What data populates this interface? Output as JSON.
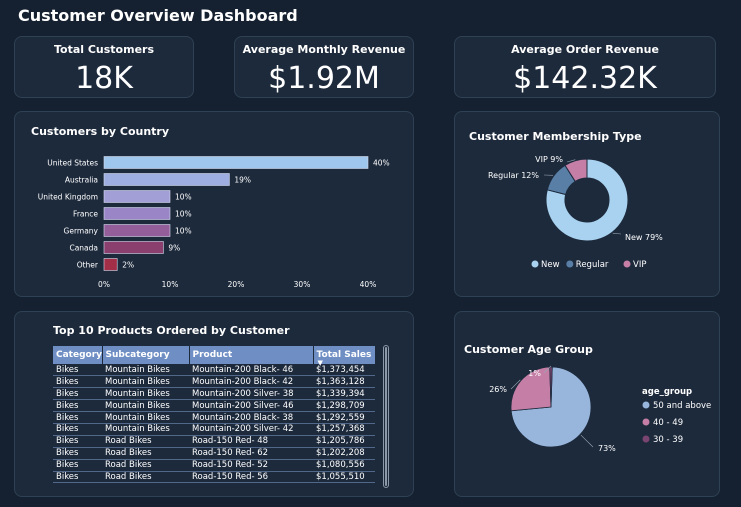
{
  "page": {
    "title": "Customer Overview Dashboard"
  },
  "kpis": {
    "total_customers": {
      "label": "Total Customers",
      "value": "18K"
    },
    "avg_monthly_revenue": {
      "label": "Average Monthly Revenue",
      "value": "$1.92M"
    },
    "avg_order_revenue": {
      "label": "Average Order Revenue",
      "value": "$142.32K"
    }
  },
  "country_chart": {
    "title": "Customers by Country",
    "colors": [
      "#9fc6ec",
      "#9eaee0",
      "#a29ed6",
      "#9a86c6",
      "#935e9a",
      "#8a3f6e",
      "#a32e48"
    ]
  },
  "membership_chart": {
    "title": "Customer Membership Type",
    "colors": {
      "New": "#a8d2f0",
      "Regular": "#5a7fa6",
      "VIP": "#c57ea5"
    }
  },
  "age_chart": {
    "title": "Customer Age Group",
    "legend_title": "age_group",
    "colors": {
      "50 and above": "#98b6dc",
      "40 - 49": "#c57ea5",
      "30 - 39": "#7a4470"
    }
  },
  "chart_data": [
    {
      "type": "bar",
      "orientation": "horizontal",
      "title": "Customers by Country",
      "categories": [
        "United States",
        "Australia",
        "United Kingdom",
        "France",
        "Germany",
        "Canada",
        "Other"
      ],
      "values": [
        40,
        19,
        10,
        10,
        10,
        9,
        2
      ],
      "data_labels": [
        "40%",
        "19%",
        "10%",
        "10%",
        "10%",
        "9%",
        "2%"
      ],
      "x_ticks": [
        "0%",
        "10%",
        "20%",
        "30%",
        "40%"
      ],
      "xlim": [
        0,
        40
      ],
      "unit": "%"
    },
    {
      "type": "pie",
      "subtype": "donut",
      "title": "Customer Membership Type",
      "labels": [
        "New",
        "Regular",
        "VIP"
      ],
      "values": [
        79,
        12,
        9
      ],
      "data_labels": [
        "New 79%",
        "Regular 12%",
        "VIP 9%"
      ],
      "legend_position": "bottom"
    },
    {
      "type": "pie",
      "title": "Customer Age Group",
      "labels": [
        "50 and above",
        "40 - 49",
        "30 - 39"
      ],
      "values": [
        73,
        26,
        1
      ],
      "data_labels": [
        "73%",
        "26%",
        "1%"
      ],
      "legend_title": "age_group",
      "legend_position": "right"
    },
    {
      "type": "table",
      "title": "Top 10 Products Ordered by Customer",
      "columns": [
        "Category",
        "Subcategory",
        "Product",
        "Total Sales"
      ],
      "rows": [
        [
          "Bikes",
          "Mountain Bikes",
          "Mountain-200 Black- 46",
          "$1,373,454"
        ],
        [
          "Bikes",
          "Mountain Bikes",
          "Mountain-200 Black- 42",
          "$1,363,128"
        ],
        [
          "Bikes",
          "Mountain Bikes",
          "Mountain-200 Silver- 38",
          "$1,339,394"
        ],
        [
          "Bikes",
          "Mountain Bikes",
          "Mountain-200 Silver- 46",
          "$1,298,709"
        ],
        [
          "Bikes",
          "Mountain Bikes",
          "Mountain-200 Black- 38",
          "$1,292,559"
        ],
        [
          "Bikes",
          "Mountain Bikes",
          "Mountain-200 Silver- 42",
          "$1,257,368"
        ],
        [
          "Bikes",
          "Road Bikes",
          "Road-150 Red- 48",
          "$1,205,786"
        ],
        [
          "Bikes",
          "Road Bikes",
          "Road-150 Red- 62",
          "$1,202,208"
        ],
        [
          "Bikes",
          "Road Bikes",
          "Road-150 Red- 52",
          "$1,080,556"
        ],
        [
          "Bikes",
          "Road Bikes",
          "Road-150 Red- 56",
          "$1,055,510"
        ]
      ]
    }
  ]
}
